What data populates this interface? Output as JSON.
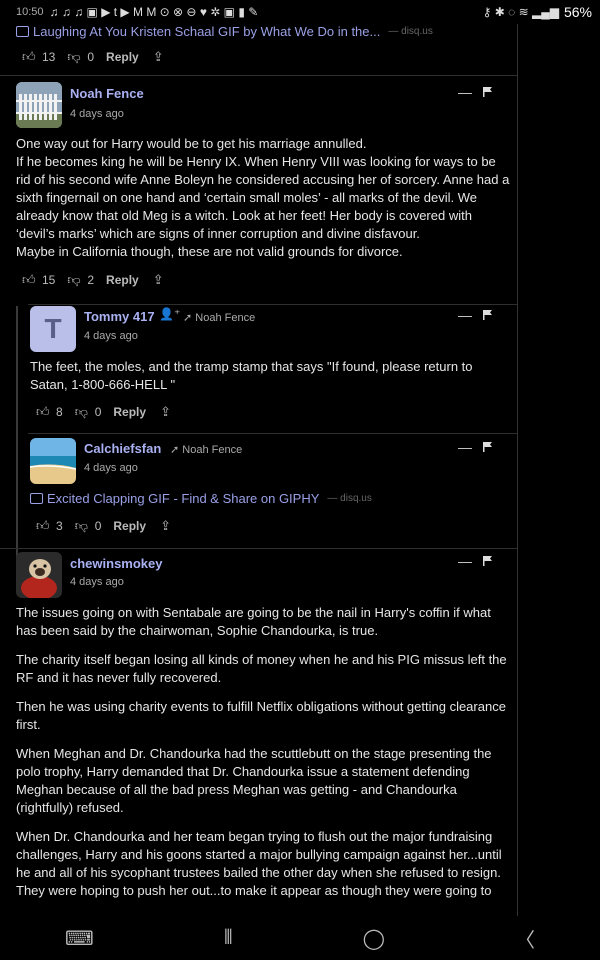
{
  "status": {
    "time": "10:50",
    "left_icons": "♫ ♫ ♫ ▣ ▶ t ▶ M M ⊙ ⊗ ⊖ ♥ ✲ ▣ ▮ ✎",
    "right_icons": "⚷ ✱ ◌ ≋ ▂▄▆",
    "battery": "56%"
  },
  "top_media": {
    "label": "Laughing At You Kristen Schaal GIF by What We Do in the...",
    "source": "— disq.us",
    "likes": "13",
    "dislikes": "0",
    "reply": "Reply"
  },
  "comments": [
    {
      "author": "Noah Fence",
      "time": "4 days ago",
      "paragraphs": [
        "One way out for Harry would be to get his marriage annulled.\nIf he becomes king he will be Henry IX. When Henry VIII was looking for ways to be rid of his second wife Anne Boleyn he considered accusing her of sorcery. Anne had a sixth fingernail on one hand and ‘certain small moles’ - all marks of the devil. We already know that old Meg is a witch. Look at her feet! Her body is covered with ‘devil’s marks’ which are signs of inner corruption and divine disfavour.\nMaybe in California though, these are not valid grounds for divorce."
      ],
      "likes": "15",
      "dislikes": "2",
      "reply": "Reply"
    },
    {
      "author": "Tommy 417",
      "avatar_letter": "T",
      "parent": "Noah Fence",
      "time": "4 days ago",
      "paragraphs": [
        "The feet, the moles, and the tramp stamp that says \"If found, please return to Satan, 1-800-666-HELL \""
      ],
      "likes": "8",
      "dislikes": "0",
      "reply": "Reply"
    },
    {
      "author": "Calchiefsfan",
      "parent": "Noah Fence",
      "time": "4 days ago",
      "media": "Excited Clapping GIF - Find & Share on GIPHY",
      "media_source": "— disq.us",
      "likes": "3",
      "dislikes": "0",
      "reply": "Reply"
    },
    {
      "author": "chewinsmokey",
      "time": "4 days ago",
      "paragraphs": [
        "The issues going on with Sentabale are going to be the nail in Harry's coffin if what has been said by the chairwoman, Sophie Chandourka, is true.",
        "The charity itself began losing all kinds of money when he and his PIG missus left the RF and it has never fully recovered.",
        "Then he was using charity events to fulfill Netflix obligations without getting clearance first.",
        "When Meghan and Dr. Chandourka had the scuttlebutt on the stage presenting the polo trophy, Harry demanded that Dr. Chandourka issue a statement defending Meghan because of all the bad press Meghan was getting - and Chandourka (rightfully) refused.",
        "When Dr. Chandourka and her team began trying to flush out the major fundraising challenges, Harry and his goons started a major bullying campaign against her...until he and all of his sycophant trustees bailed the other day when she refused to resign. They were hoping to push her out...to make it appear as though they were going to"
      ]
    }
  ],
  "colors": {
    "background": "#000000",
    "link": "#a9b1f2",
    "text": "#e6e6e6"
  }
}
